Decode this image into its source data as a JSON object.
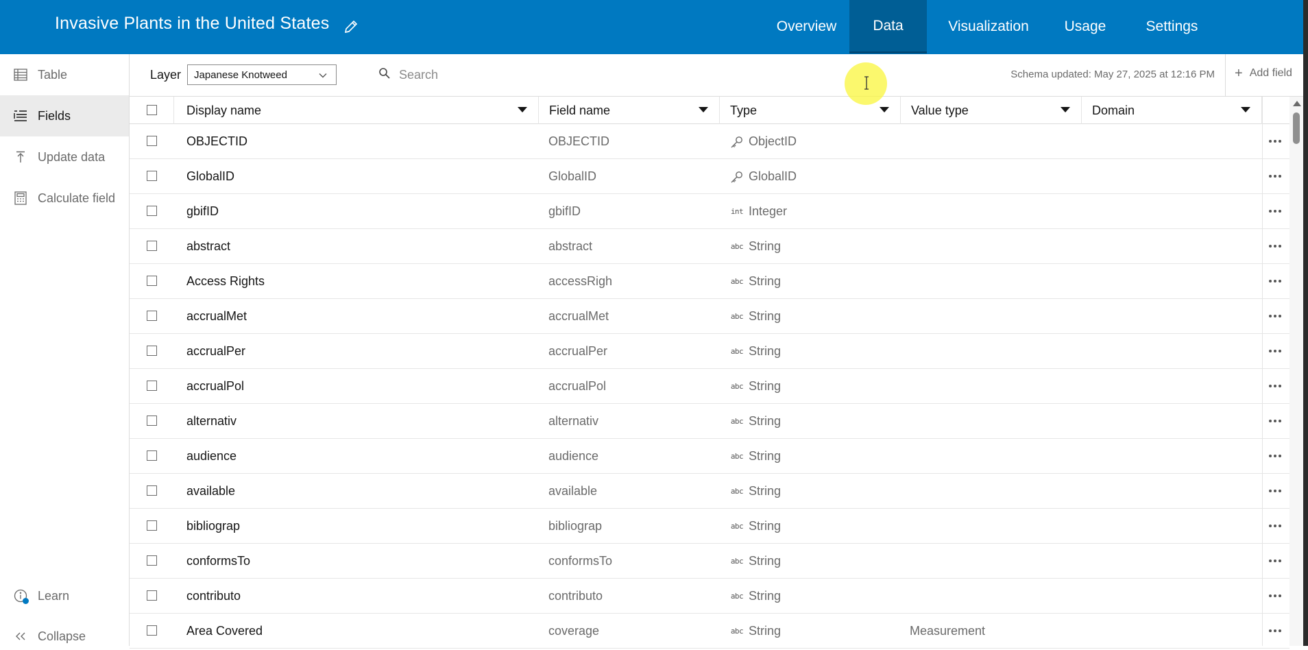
{
  "app": {
    "title": "Invasive Plants in the United States"
  },
  "nav": {
    "tabs": [
      {
        "label": "Overview",
        "active": false
      },
      {
        "label": "Data",
        "active": true
      },
      {
        "label": "Visualization",
        "active": false
      },
      {
        "label": "Usage",
        "active": false
      },
      {
        "label": "Settings",
        "active": false
      }
    ]
  },
  "sidebar": {
    "items": [
      {
        "label": "Table",
        "icon": "table-icon",
        "active": false
      },
      {
        "label": "Fields",
        "icon": "fields-list-icon",
        "active": true
      },
      {
        "label": "Update data",
        "icon": "upload-icon",
        "active": false
      },
      {
        "label": "Calculate field",
        "icon": "calculator-icon",
        "active": false
      }
    ],
    "learn_label": "Learn",
    "collapse_label": "Collapse"
  },
  "toolbar": {
    "layer_label": "Layer",
    "layer_value": "Japanese Knotweed",
    "search_placeholder": "Search",
    "schema_status": "Schema updated: May 27, 2025 at 12:16 PM",
    "add_field_label": "Add field"
  },
  "table": {
    "columns": [
      "Display name",
      "Field name",
      "Type",
      "Value type",
      "Domain"
    ],
    "rows": [
      {
        "display": "OBJECTID",
        "field": "OBJECTID",
        "type": "ObjectID",
        "type_icon": "key",
        "value_type": "",
        "domain": ""
      },
      {
        "display": "GlobalID",
        "field": "GlobalID",
        "type": "GlobalID",
        "type_icon": "key",
        "value_type": "",
        "domain": ""
      },
      {
        "display": "gbifID",
        "field": "gbifID",
        "type": "Integer",
        "type_icon": "int",
        "value_type": "",
        "domain": ""
      },
      {
        "display": "abstract",
        "field": "abstract",
        "type": "String",
        "type_icon": "abc",
        "value_type": "",
        "domain": ""
      },
      {
        "display": "Access Rights",
        "field": "accessRigh",
        "type": "String",
        "type_icon": "abc",
        "value_type": "",
        "domain": ""
      },
      {
        "display": "accrualMet",
        "field": "accrualMet",
        "type": "String",
        "type_icon": "abc",
        "value_type": "",
        "domain": ""
      },
      {
        "display": "accrualPer",
        "field": "accrualPer",
        "type": "String",
        "type_icon": "abc",
        "value_type": "",
        "domain": ""
      },
      {
        "display": "accrualPol",
        "field": "accrualPol",
        "type": "String",
        "type_icon": "abc",
        "value_type": "",
        "domain": ""
      },
      {
        "display": "alternativ",
        "field": "alternativ",
        "type": "String",
        "type_icon": "abc",
        "value_type": "",
        "domain": ""
      },
      {
        "display": "audience",
        "field": "audience",
        "type": "String",
        "type_icon": "abc",
        "value_type": "",
        "domain": ""
      },
      {
        "display": "available",
        "field": "available",
        "type": "String",
        "type_icon": "abc",
        "value_type": "",
        "domain": ""
      },
      {
        "display": "bibliograp",
        "field": "bibliograp",
        "type": "String",
        "type_icon": "abc",
        "value_type": "",
        "domain": ""
      },
      {
        "display": "conformsTo",
        "field": "conformsTo",
        "type": "String",
        "type_icon": "abc",
        "value_type": "",
        "domain": ""
      },
      {
        "display": "contributo",
        "field": "contributo",
        "type": "String",
        "type_icon": "abc",
        "value_type": "",
        "domain": ""
      },
      {
        "display": "Area Covered",
        "field": "coverage",
        "type": "String",
        "type_icon": "abc",
        "value_type": "Measurement",
        "domain": ""
      }
    ]
  },
  "type_icon_text": {
    "int": "int",
    "abc": "abc"
  },
  "colors": {
    "header_bg": "#0079c1",
    "active_tab_bg": "#005e95",
    "accent": "#0079c1"
  }
}
